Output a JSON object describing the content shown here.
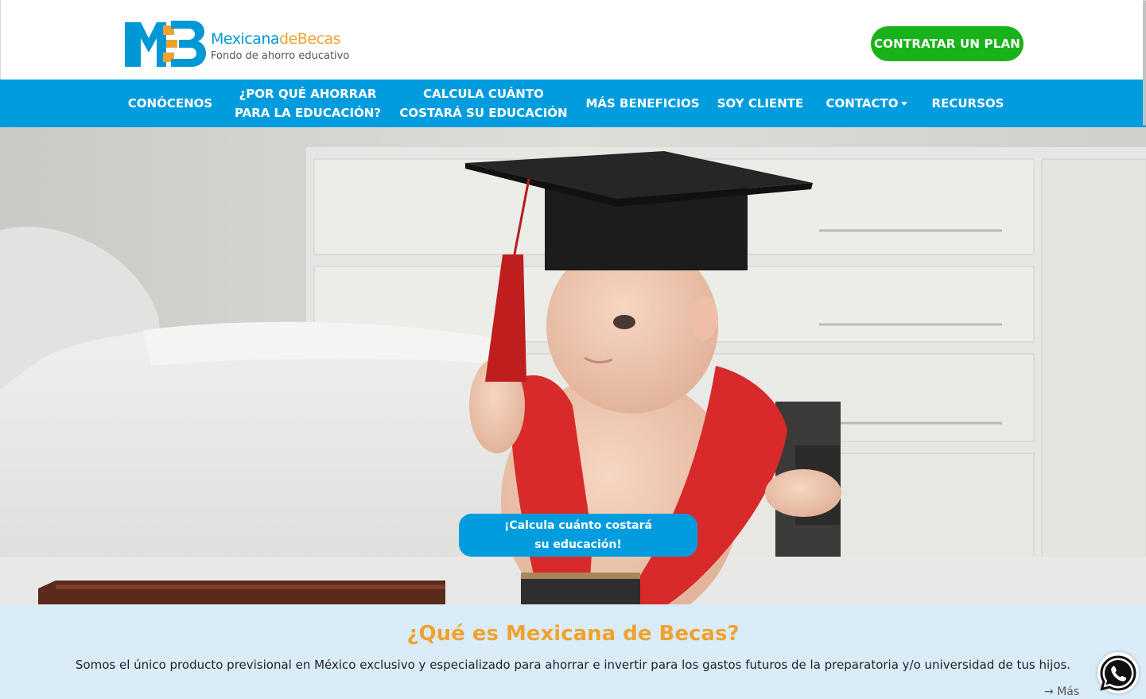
{
  "header": {
    "logo": {
      "brand_part1": "Mexicana",
      "brand_part2": "deBecas",
      "tagline": "Fondo de ahorro educativo",
      "mark_text": "MB"
    },
    "cta_label": "CONTRATAR UN PLAN"
  },
  "nav": {
    "items": [
      {
        "label": "CONÓCENOS"
      },
      {
        "label": "¿POR QUÉ AHORRAR",
        "label2": "PARA LA EDUCACIÓN?"
      },
      {
        "label": "CALCULA CUÁNTO",
        "label2": "COSTARÁ SU EDUCACIÓN"
      },
      {
        "label": "MÁS BENEFICIOS"
      },
      {
        "label": "SOY CLIENTE"
      },
      {
        "label": "CONTACTO",
        "has_dropdown": true
      },
      {
        "label": "RECURSOS"
      }
    ]
  },
  "hero": {
    "cta_line1": "¡Calcula cuánto costará",
    "cta_line2": "su educación!"
  },
  "about": {
    "title": "¿Qué es Mexicana de Becas?",
    "text": "Somos el único producto previsional en México exclusivo y especializado para ahorrar e invertir para los gastos futuros de la preparatoria y/o universidad de tus hijos.",
    "more": "→ Más"
  },
  "icons": {
    "whatsapp": "whatsapp-icon",
    "dropdown": "chevron-down-icon"
  },
  "colors": {
    "primary_blue": "#009cde",
    "brand_orange": "#f1a22e",
    "cta_green": "#1ab21a",
    "section_bg": "#d9ecf8"
  }
}
